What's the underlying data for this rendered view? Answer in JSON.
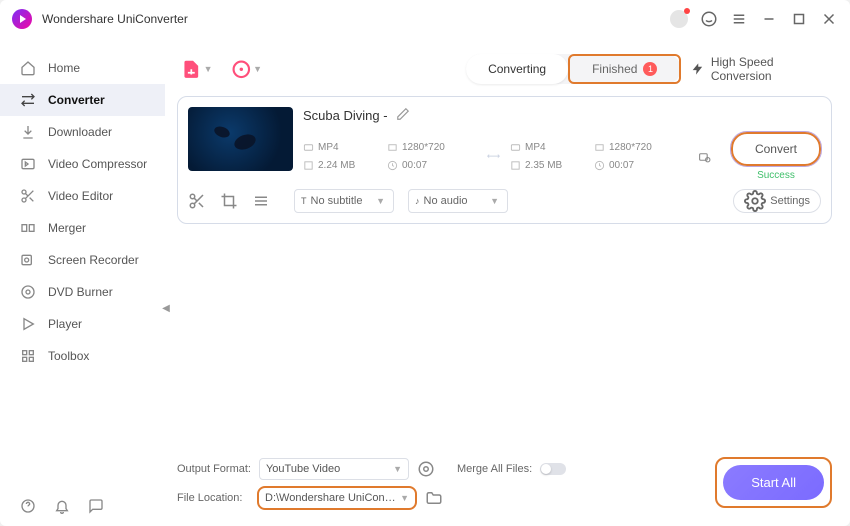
{
  "app": {
    "title": "Wondershare UniConverter"
  },
  "sidebar": {
    "items": [
      {
        "label": "Home"
      },
      {
        "label": "Converter"
      },
      {
        "label": "Downloader"
      },
      {
        "label": "Video Compressor"
      },
      {
        "label": "Video Editor"
      },
      {
        "label": "Merger"
      },
      {
        "label": "Screen Recorder"
      },
      {
        "label": "DVD Burner"
      },
      {
        "label": "Player"
      },
      {
        "label": "Toolbox"
      }
    ]
  },
  "tabs": {
    "converting": "Converting",
    "finished": "Finished",
    "finished_count": "1"
  },
  "hsc": "High Speed Conversion",
  "task": {
    "title": "Scuba Diving -",
    "src": {
      "fmt": "MP4",
      "res": "1280*720",
      "size": "2.24 MB",
      "dur": "00:07"
    },
    "dst": {
      "fmt": "MP4",
      "res": "1280*720",
      "size": "2.35 MB",
      "dur": "00:07"
    },
    "subtitle": "No subtitle",
    "audio": "No audio",
    "settings": "Settings",
    "convert": "Convert",
    "status": "Success"
  },
  "footer": {
    "output_format_label": "Output Format:",
    "output_format_value": "YouTube Video",
    "file_location_label": "File Location:",
    "file_location_value": "D:\\Wondershare UniConverter",
    "merge_label": "Merge All Files:",
    "start_all": "Start All"
  }
}
